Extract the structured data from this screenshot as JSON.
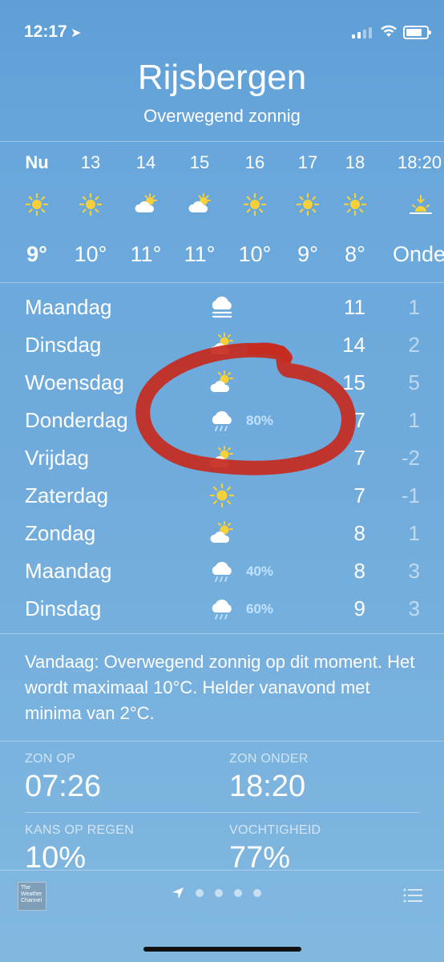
{
  "status": {
    "time": "12:17"
  },
  "location": {
    "city": "Rijsbergen",
    "condition": "Overwegend zonnig"
  },
  "hourly": [
    {
      "label": "Nu",
      "icon": "sun-icon",
      "temp": "9°"
    },
    {
      "label": "13",
      "icon": "sun-icon",
      "temp": "10°"
    },
    {
      "label": "14",
      "icon": "partly-cloudy-icon",
      "temp": "11°"
    },
    {
      "label": "15",
      "icon": "partly-cloudy-icon",
      "temp": "11°"
    },
    {
      "label": "16",
      "icon": "sun-icon",
      "temp": "10°"
    },
    {
      "label": "17",
      "icon": "sun-icon",
      "temp": "9°"
    },
    {
      "label": "18",
      "icon": "sun-icon",
      "temp": "8°"
    },
    {
      "label": "18:20",
      "icon": "sunset-icon",
      "temp": "Onde"
    }
  ],
  "daily": [
    {
      "day": "Maandag",
      "icon": "fog-icon",
      "precip": "",
      "high": "11",
      "low": "1"
    },
    {
      "day": "Dinsdag",
      "icon": "partly-cloudy-icon",
      "precip": "",
      "high": "14",
      "low": "2"
    },
    {
      "day": "Woensdag",
      "icon": "partly-cloudy-icon",
      "precip": "",
      "high": "15",
      "low": "5"
    },
    {
      "day": "Donderdag",
      "icon": "rain-cloud-icon",
      "precip": "80%",
      "high": "7",
      "low": "1"
    },
    {
      "day": "Vrijdag",
      "icon": "partly-cloudy-icon",
      "precip": "",
      "high": "7",
      "low": "-2"
    },
    {
      "day": "Zaterdag",
      "icon": "sun-icon",
      "precip": "",
      "high": "7",
      "low": "-1"
    },
    {
      "day": "Zondag",
      "icon": "partly-cloudy-icon",
      "precip": "",
      "high": "8",
      "low": "1"
    },
    {
      "day": "Maandag",
      "icon": "rain-cloud-icon",
      "precip": "40%",
      "high": "8",
      "low": "3"
    },
    {
      "day": "Dinsdag",
      "icon": "rain-cloud-icon",
      "precip": "60%",
      "high": "9",
      "low": "3"
    }
  ],
  "summary": "Vandaag: Overwegend zonnig op dit moment. Het wordt maximaal 10°C. Helder vanavond met minima van 2°C.",
  "details": {
    "sunrise_label": "ZON OP",
    "sunrise_value": "07:26",
    "sunset_label": "ZON ONDER",
    "sunset_value": "18:20",
    "rain_label": "KANS OP REGEN",
    "rain_value": "10%",
    "humidity_label": "VOCHTIGHEID",
    "humidity_value": "77%"
  },
  "footer": {
    "logo_text": "The Weather Channel"
  },
  "colors": {
    "sun": "#f5d03b",
    "precip": "#bfe3ff",
    "annotation": "#c62a1d"
  }
}
